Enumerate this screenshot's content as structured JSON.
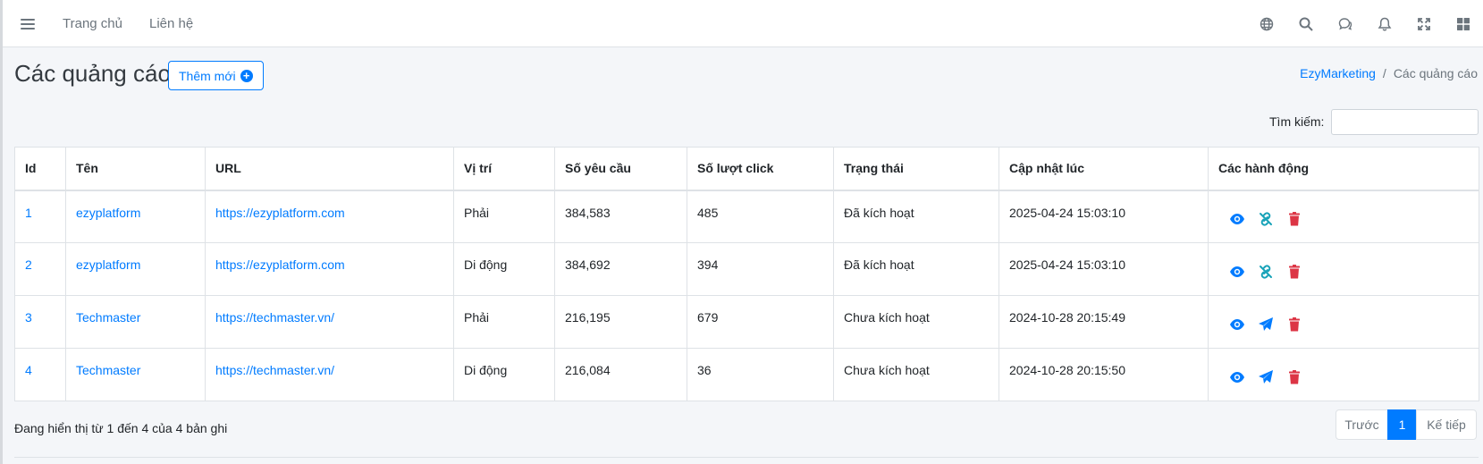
{
  "nav": {
    "home": "Trang chủ",
    "contact": "Liên hệ",
    "icons": [
      "globe-icon",
      "search-icon",
      "comments-icon",
      "bell-icon",
      "expand-icon",
      "grid-icon"
    ]
  },
  "header": {
    "title": "Các quảng cáo",
    "add_button": "Thêm mới"
  },
  "breadcrumb": {
    "root": "EzyMarketing",
    "separator": "/",
    "current": "Các quảng cáo"
  },
  "search": {
    "label": "Tìm kiếm:",
    "value": ""
  },
  "table": {
    "columns": [
      "Id",
      "Tên",
      "URL",
      "Vị trí",
      "Số yêu cầu",
      "Số lượt click",
      "Trạng thái",
      "Cập nhật lúc",
      "Các hành động"
    ],
    "rows": [
      {
        "id": "1",
        "name": "ezyplatform",
        "url": "https://ezyplatform.com",
        "position": "Phải",
        "requests": "384,583",
        "clicks": "485",
        "status": "Đã kích hoạt",
        "updated": "2025-04-24 15:03:10"
      },
      {
        "id": "2",
        "name": "ezyplatform",
        "url": "https://ezyplatform.com",
        "position": "Di động",
        "requests": "384,692",
        "clicks": "394",
        "status": "Đã kích hoạt",
        "updated": "2025-04-24 15:03:10"
      },
      {
        "id": "3",
        "name": "Techmaster",
        "url": "https://techmaster.vn/",
        "position": "Phải",
        "requests": "216,195",
        "clicks": "679",
        "status": "Chưa kích hoạt",
        "updated": "2024-10-28 20:15:49"
      },
      {
        "id": "4",
        "name": "Techmaster",
        "url": "https://techmaster.vn/",
        "position": "Di động",
        "requests": "216,084",
        "clicks": "36",
        "status": "Chưa kích hoạt",
        "updated": "2024-10-28 20:15:50"
      }
    ]
  },
  "footer": {
    "info": "Đang hiển thị từ 1 đến 4 của 4 bản ghi",
    "prev": "Trước",
    "page": "1",
    "next": "Kế tiếp"
  },
  "colors": {
    "primary": "#007bff",
    "danger": "#dc3545",
    "teal": "#17a2b8"
  }
}
